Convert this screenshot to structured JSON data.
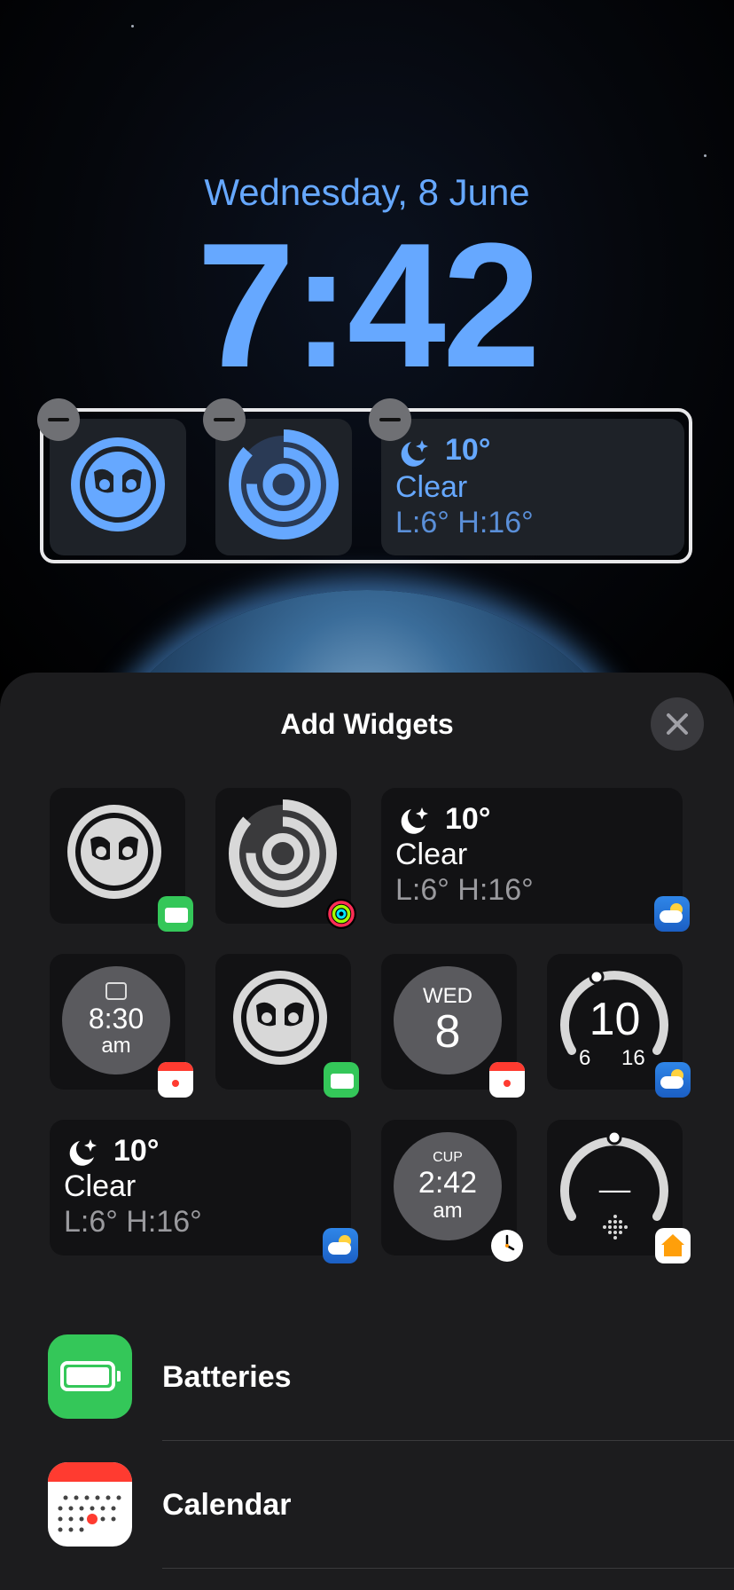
{
  "lockscreen": {
    "date": "Wednesday, 8 June",
    "time": "7:42",
    "weather": {
      "temp": "10°",
      "condition": "Clear",
      "range": "L:6° H:16°"
    }
  },
  "sheet": {
    "title": "Add Widgets",
    "widgets": {
      "weather_rect": {
        "temp": "10°",
        "condition": "Clear",
        "range": "L:6° H:16°"
      },
      "alarm": {
        "time": "8:30",
        "suffix": "am"
      },
      "calendar": {
        "day": "WED",
        "date": "8"
      },
      "temp_gauge": {
        "value": "10",
        "low": "6",
        "high": "16"
      },
      "weather_rect2": {
        "temp": "10°",
        "condition": "Clear",
        "range": "L:6° H:16°"
      },
      "world_clock": {
        "city": "CUP",
        "time": "2:42",
        "suffix": "am"
      },
      "home": {
        "value": "––"
      }
    },
    "apps": [
      {
        "label": "Batteries"
      },
      {
        "label": "Calendar"
      }
    ]
  },
  "colors": {
    "accent": "#66a8ff",
    "green": "#34c759",
    "red": "#ff3b30",
    "sheet": "#1c1c1e"
  }
}
